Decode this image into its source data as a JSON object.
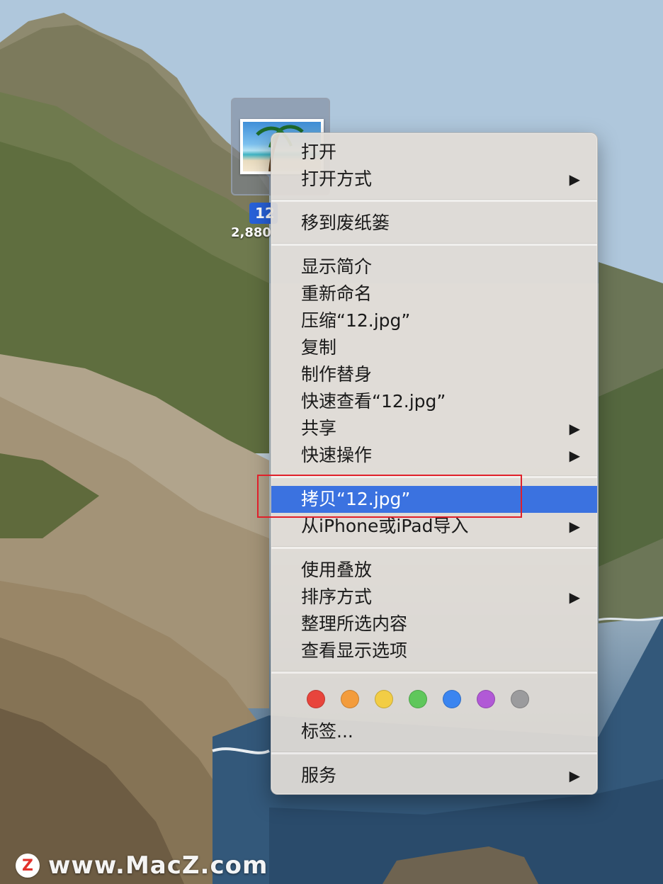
{
  "file": {
    "name_truncated": "12",
    "size_truncated": "2,880"
  },
  "menu": {
    "items": [
      {
        "label": "打开",
        "submenu": false
      },
      {
        "label": "打开方式",
        "submenu": true
      },
      {
        "label": "移到废纸篓",
        "submenu": false
      },
      {
        "label": "显示简介",
        "submenu": false
      },
      {
        "label": "重新命名",
        "submenu": false
      },
      {
        "label": "压缩“12.jpg”",
        "submenu": false
      },
      {
        "label": "复制",
        "submenu": false
      },
      {
        "label": "制作替身",
        "submenu": false
      },
      {
        "label": "快速查看“12.jpg”",
        "submenu": false
      },
      {
        "label": "共享",
        "submenu": true
      },
      {
        "label": "快速操作",
        "submenu": true
      },
      {
        "label": "拷贝“12.jpg”",
        "submenu": false,
        "highlighted": true
      },
      {
        "label": "从iPhone或iPad导入",
        "submenu": true
      },
      {
        "label": "使用叠放",
        "submenu": false
      },
      {
        "label": "排序方式",
        "submenu": true
      },
      {
        "label": "整理所选内容",
        "submenu": false
      },
      {
        "label": "查看显示选项",
        "submenu": false
      },
      {
        "label": "标签...",
        "submenu": false
      },
      {
        "label": "服务",
        "submenu": true
      }
    ],
    "submenu_arrow": "▶",
    "tag_colors": [
      "#e8453c",
      "#f39c3c",
      "#f2cd45",
      "#5fc75b",
      "#3b85f0",
      "#b159d6",
      "#9b9b9d"
    ],
    "highlight_color": "#3b72e0"
  },
  "annotation": {
    "color": "#e0202a"
  },
  "watermark": {
    "logo_letter": "Z",
    "text": "www.MacZ.com"
  }
}
